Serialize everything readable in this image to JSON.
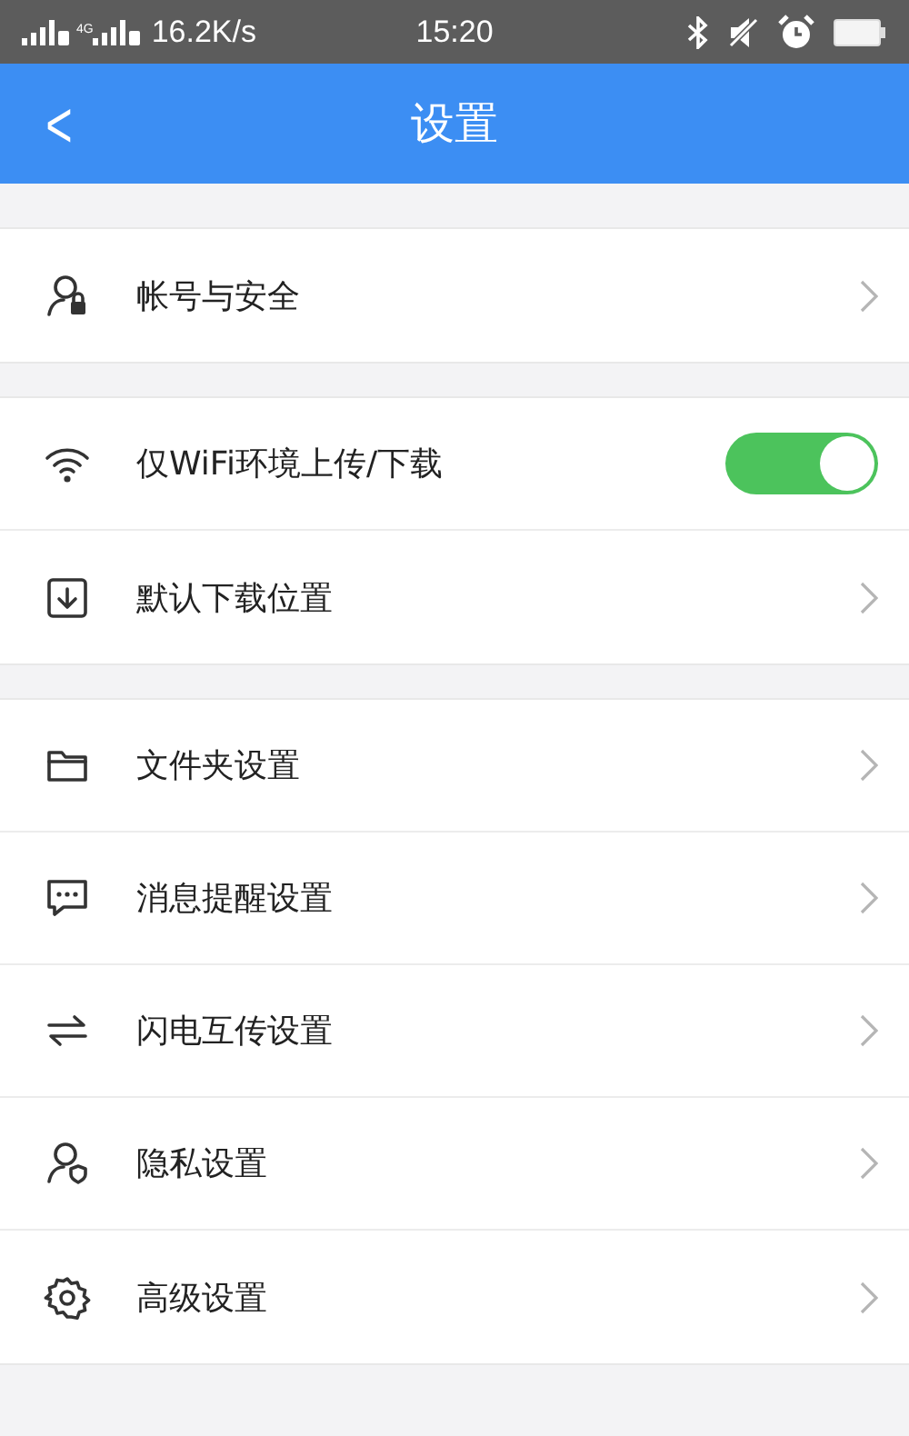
{
  "status_bar": {
    "network_type": "4G",
    "network_speed": "16.2K/s",
    "time": "15:20"
  },
  "header": {
    "back": "<",
    "title": "设置"
  },
  "sections": [
    {
      "items": [
        {
          "kind": "link",
          "label": "帐号与安全"
        }
      ]
    },
    {
      "items": [
        {
          "kind": "toggle",
          "label": "仅WiFi环境上传/下载",
          "on": true
        },
        {
          "kind": "link",
          "label": "默认下载位置"
        }
      ]
    },
    {
      "items": [
        {
          "kind": "link",
          "label": "文件夹设置"
        },
        {
          "kind": "link",
          "label": "消息提醒设置"
        },
        {
          "kind": "link",
          "label": "闪电互传设置"
        },
        {
          "kind": "link",
          "label": "隐私设置"
        },
        {
          "kind": "link",
          "label": "高级设置"
        }
      ]
    }
  ]
}
